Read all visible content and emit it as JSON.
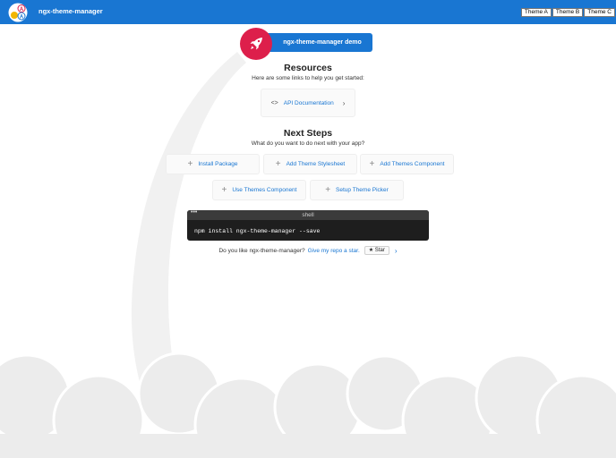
{
  "toolbar": {
    "title": "ngx-theme-manager",
    "themes": [
      "Theme A",
      "Theme B",
      "Theme C"
    ],
    "color": "#1976d2"
  },
  "highlight_card": {
    "label": "ngx-theme-manager demo",
    "icon": "rocket-icon",
    "icon_color": "#dd1f4b"
  },
  "resources": {
    "title": "Resources",
    "subtitle": "Here are some links to help you get started:",
    "links": [
      {
        "label": "API Documentation",
        "icon": "code-icon"
      }
    ]
  },
  "next_steps": {
    "title": "Next Steps",
    "subtitle": "What do you want to do next with your app?",
    "row1": [
      "Install Package",
      "Add Theme Stylesheet",
      "Add Themes Component"
    ],
    "row2": [
      "Use Themes Component",
      "Setup Theme Picker"
    ]
  },
  "terminal": {
    "dots": "•••",
    "title": "shell",
    "command": "npm install ngx-theme-manager --save"
  },
  "star_line": {
    "text": "Do you like ngx-theme-manager?",
    "link": "Give my repo a star.",
    "button": "★ Star"
  }
}
